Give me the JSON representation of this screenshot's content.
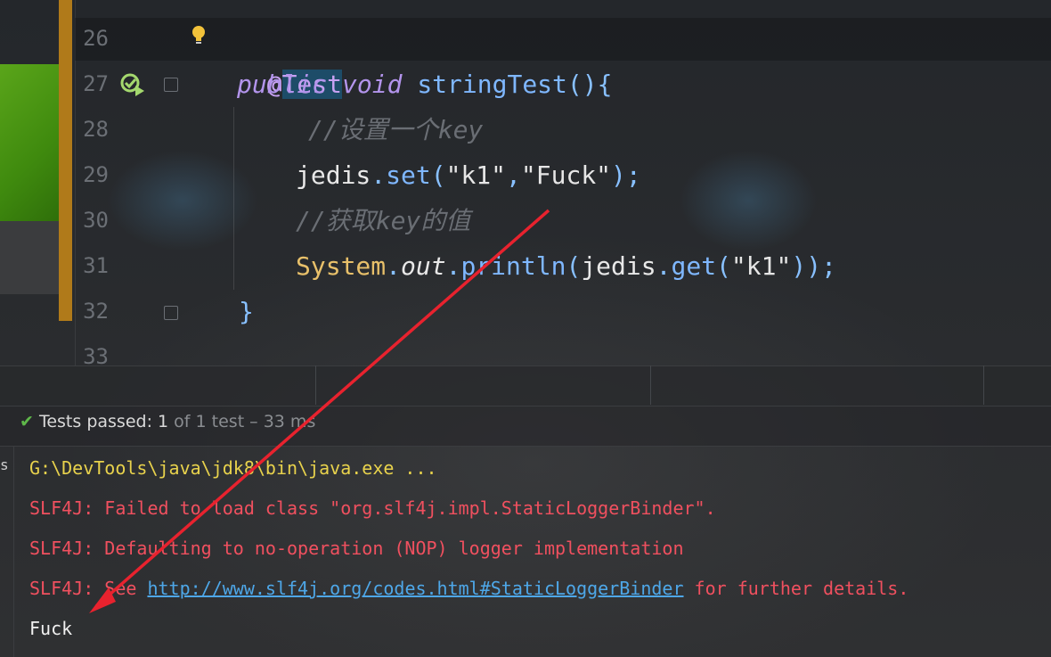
{
  "editor": {
    "line_numbers": [
      "26",
      "27",
      "28",
      "29",
      "30",
      "31",
      "32",
      "33"
    ],
    "lines": {
      "l26_annotation": "@Test",
      "l27_kw_public": "public",
      "l27_kw_void": "void",
      "l27_method": "stringTest",
      "l27_paren": "(){",
      "l28_comment": "//设置一个key",
      "l29_obj": "jedis",
      "l29_dot": ".",
      "l29_method": "set",
      "l29_open": "(",
      "l29_arg1": "\"k1\"",
      "l29_comma": ",",
      "l29_arg2": "\"Fuck\"",
      "l29_close": ");",
      "l30_comment": "//获取key的值",
      "l31_class": "System",
      "l31_dot1": ".",
      "l31_field": "out",
      "l31_dot2": ".",
      "l31_method": "println",
      "l31_open": "(",
      "l31_obj": "jedis",
      "l31_dot3": ".",
      "l31_get": "get",
      "l31_open2": "(",
      "l31_arg": "\"k1\"",
      "l31_close": "));",
      "l32_brace": "}"
    },
    "icons": [
      "lightbulb-icon",
      "run-test-icon",
      "fold-icon"
    ]
  },
  "test_status": {
    "label": "Tests passed:",
    "passed": "1",
    "of_text": "of 1 test – 33 ms"
  },
  "console": {
    "left_strip_char": "s",
    "cmd_line": "G:\\DevTools\\java\\jdk8\\bin\\java.exe ...",
    "err1": "SLF4J: Failed to load class \"org.slf4j.impl.StaticLoggerBinder\".",
    "err2": "SLF4J: Defaulting to no-operation (NOP) logger implementation",
    "err3_prefix": "SLF4J: See ",
    "err3_link": "http://www.slf4j.org/codes.html#StaticLoggerBinder",
    "err3_suffix": " for further details.",
    "output": "Fuck"
  },
  "colors": {
    "annotation_arrow": "#e8222e",
    "change_bar": "#b07a1a",
    "pass_check": "#5fb84a"
  }
}
